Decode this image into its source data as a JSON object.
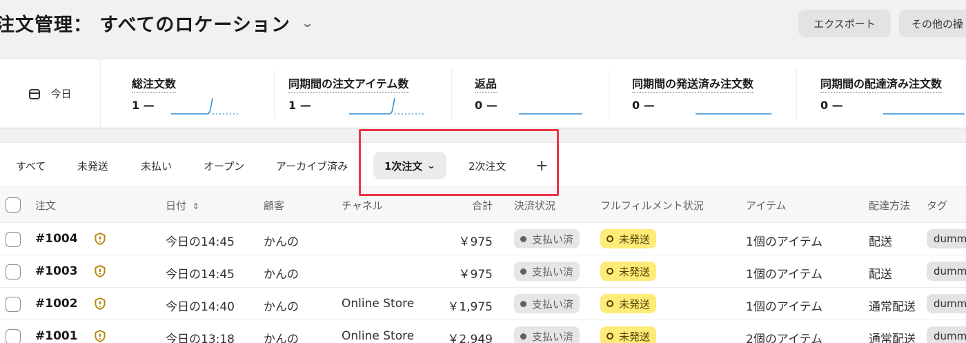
{
  "header": {
    "title": "注文管理： すべてのロケーション",
    "export_label": "エクスポート",
    "more_label": "その他の操"
  },
  "metrics": {
    "date_label": "今日",
    "items": [
      {
        "label": "総注文数",
        "value": "1 —"
      },
      {
        "label": "同期間の注文アイテム数",
        "value": "1 —"
      },
      {
        "label": "返品",
        "value": "0 —"
      },
      {
        "label": "同期間の発送済み注文数",
        "value": "0 —"
      },
      {
        "label": "同期間の配達済み注文数",
        "value": "0 —"
      }
    ]
  },
  "tabs": {
    "items": [
      "すべて",
      "未発送",
      "未払い",
      "オープン",
      "アーカイブ済み",
      "1次注文",
      "2次注文"
    ],
    "active": "1次注文",
    "add_label": "+"
  },
  "table": {
    "columns": {
      "order": "注文",
      "date": "日付",
      "customer": "顧客",
      "channel": "チャネル",
      "total": "合計",
      "payment": "決済状況",
      "fulfillment": "フルフィルメント状況",
      "items": "アイテム",
      "delivery": "配達方法",
      "tags": "タグ"
    },
    "rows": [
      {
        "order": "#1004",
        "date": "今日の14:45",
        "customer": "かんの",
        "channel": "",
        "total": "￥975",
        "payment": "支払い済",
        "fulfillment": "未発送",
        "items": "1個のアイテム",
        "delivery": "配送",
        "tag": "dumm"
      },
      {
        "order": "#1003",
        "date": "今日の14:45",
        "customer": "かんの",
        "channel": "",
        "total": "￥975",
        "payment": "支払い済",
        "fulfillment": "未発送",
        "items": "1個のアイテム",
        "delivery": "配送",
        "tag": "dumm"
      },
      {
        "order": "#1002",
        "date": "今日の14:40",
        "customer": "かんの",
        "channel": "Online Store",
        "total": "￥1,975",
        "payment": "支払い済",
        "fulfillment": "未発送",
        "items": "1個のアイテム",
        "delivery": "通常配送",
        "tag": "dumm"
      },
      {
        "order": "#1001",
        "date": "今日の13:18",
        "customer": "かんの",
        "channel": "Online Store",
        "total": "￥2,949",
        "payment": "支払い済",
        "fulfillment": "未発送",
        "items": "2個のアイテム",
        "delivery": "通常配送",
        "tag": "dumm"
      }
    ]
  },
  "colors": {
    "accent_highlight": "#ee3344",
    "unfulfilled_badge": "#ffeb78",
    "sparkline": "#2f8fd8"
  }
}
